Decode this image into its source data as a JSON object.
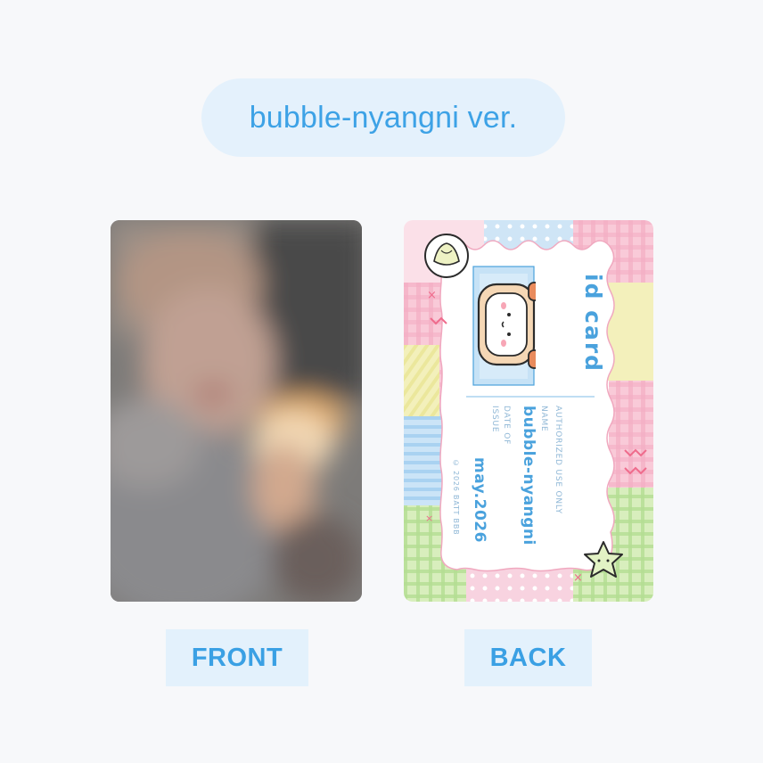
{
  "title": "bubble-nyangni ver.",
  "front_label": "FRONT",
  "back_label": "BACK",
  "id_card": {
    "title": "id card",
    "field_name_label": "NAME",
    "name": "bubble-nyangni",
    "authorized": "AUTHORIZED USE ONLY",
    "field_date_label_1": "DATE OF",
    "field_date_label_2": "ISSUE",
    "date": "may.2026",
    "copyright": "© 2026 BATT BBB"
  },
  "colors": {
    "accent": "#3da2e6",
    "pill_bg": "#e4f1fc",
    "page_bg": "#f7f8fa",
    "pastel_pink": "#f7c9d8",
    "pastel_blue": "#c9e3f7",
    "pastel_green": "#cfeab3",
    "pastel_yellow": "#f3efb4"
  }
}
